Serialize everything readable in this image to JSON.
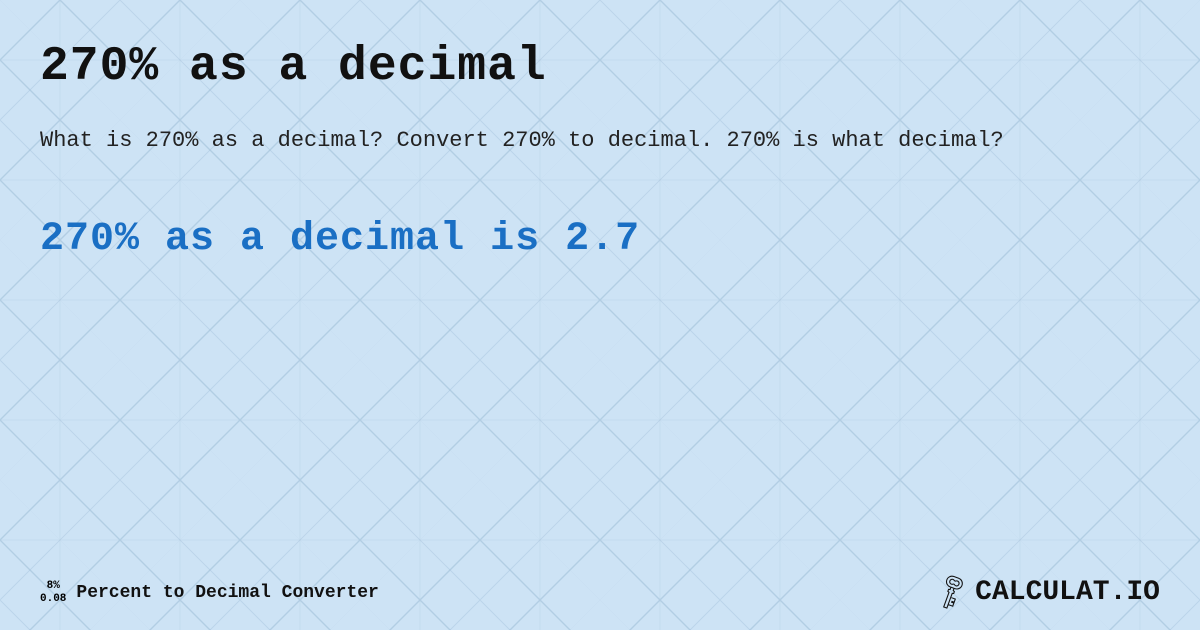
{
  "page": {
    "background_color": "#cde3f5",
    "pattern_color": "#b8d4ec",
    "pattern_color2": "#a8c8e8"
  },
  "header": {
    "title": "270% as a decimal"
  },
  "description": {
    "text": "What is 270% as a decimal? Convert 270% to decimal. 270% is what decimal?"
  },
  "result": {
    "text": "270% as a decimal is 2.7"
  },
  "footer": {
    "fraction_numerator": "8%",
    "fraction_denominator": "0.08",
    "converter_label": "Percent to Decimal Converter",
    "brand": "CALCULAT.IO"
  },
  "icons": {
    "key": "🔑"
  }
}
